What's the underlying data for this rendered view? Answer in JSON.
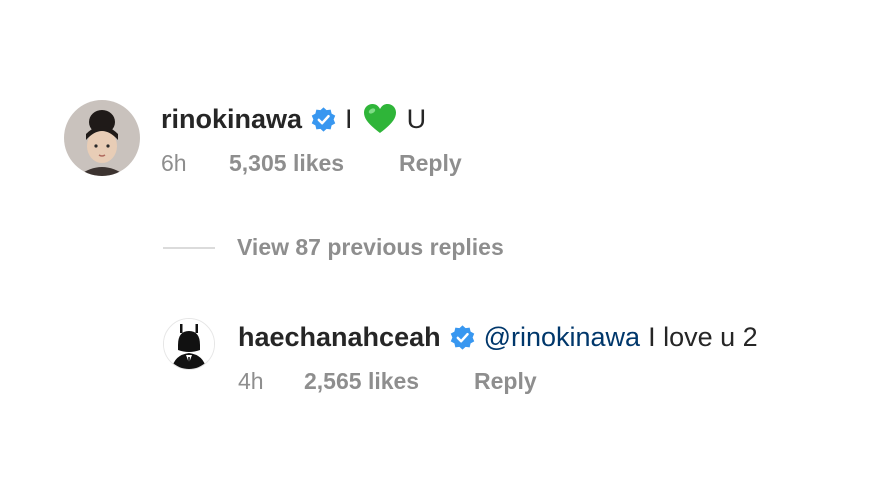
{
  "comment1": {
    "username": "rinokinawa",
    "text_before": "I",
    "emoji": "green-heart",
    "text_after": "U",
    "time": "6h",
    "likes": "5,305 likes",
    "reply": "Reply"
  },
  "view_replies": {
    "label": "View 87 previous replies"
  },
  "comment2": {
    "username": "haechanahceah",
    "mention": "@rinokinawa",
    "text": "I love u 2",
    "time": "4h",
    "likes": "2,565 likes",
    "reply": "Reply"
  },
  "colors": {
    "verified_blue": "#3897f0",
    "mention_blue": "#00376b",
    "meta_gray": "#8e8e8e",
    "heart_green": "#2fb539"
  },
  "icons": [
    "avatar-rinokinawa",
    "verified-badge-icon",
    "green-heart-icon",
    "avatar-haechanahceah"
  ]
}
